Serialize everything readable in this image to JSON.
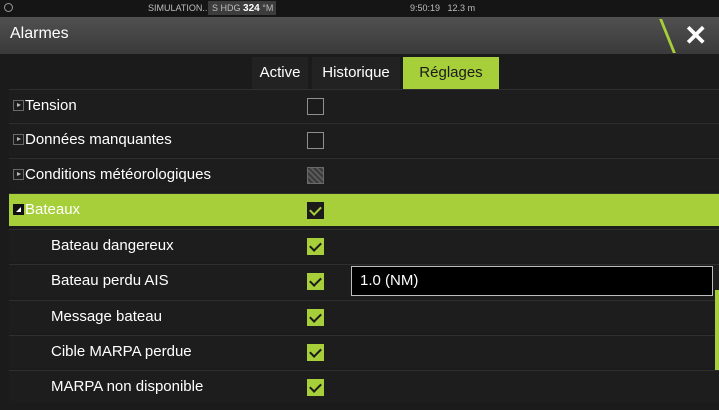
{
  "statusbar": {
    "simulation": "SIMULATION...",
    "hdg_prefix": "S HDG",
    "hdg_value": "324",
    "hdg_unit": "°M",
    "time": "9:50:19",
    "distance": "12.3 m"
  },
  "window": {
    "title": "Alarmes"
  },
  "tabs": [
    {
      "label": "Active",
      "selected": false
    },
    {
      "label": "Historique",
      "selected": false
    },
    {
      "label": "Réglages",
      "selected": true
    }
  ],
  "rows": [
    {
      "label": "Tension",
      "checked": false
    },
    {
      "label": "Données manquantes",
      "checked": false
    },
    {
      "label": "Conditions météorologiques",
      "state": "partial"
    },
    {
      "label": "Bateaux",
      "checked": true,
      "expanded": true,
      "highlighted": true
    },
    {
      "label": "Bateau dangereux",
      "checked": true
    },
    {
      "label": "Bateau perdu AIS",
      "checked": true,
      "value": "1.0 (NM)"
    },
    {
      "label": "Message bateau",
      "checked": true
    },
    {
      "label": "Cible MARPA perdue",
      "checked": true
    },
    {
      "label": "MARPA non disponible",
      "checked": true
    }
  ],
  "colors": {
    "accent": "#a6cf39",
    "background": "#1b1b1b",
    "titlebar": "#444444"
  }
}
